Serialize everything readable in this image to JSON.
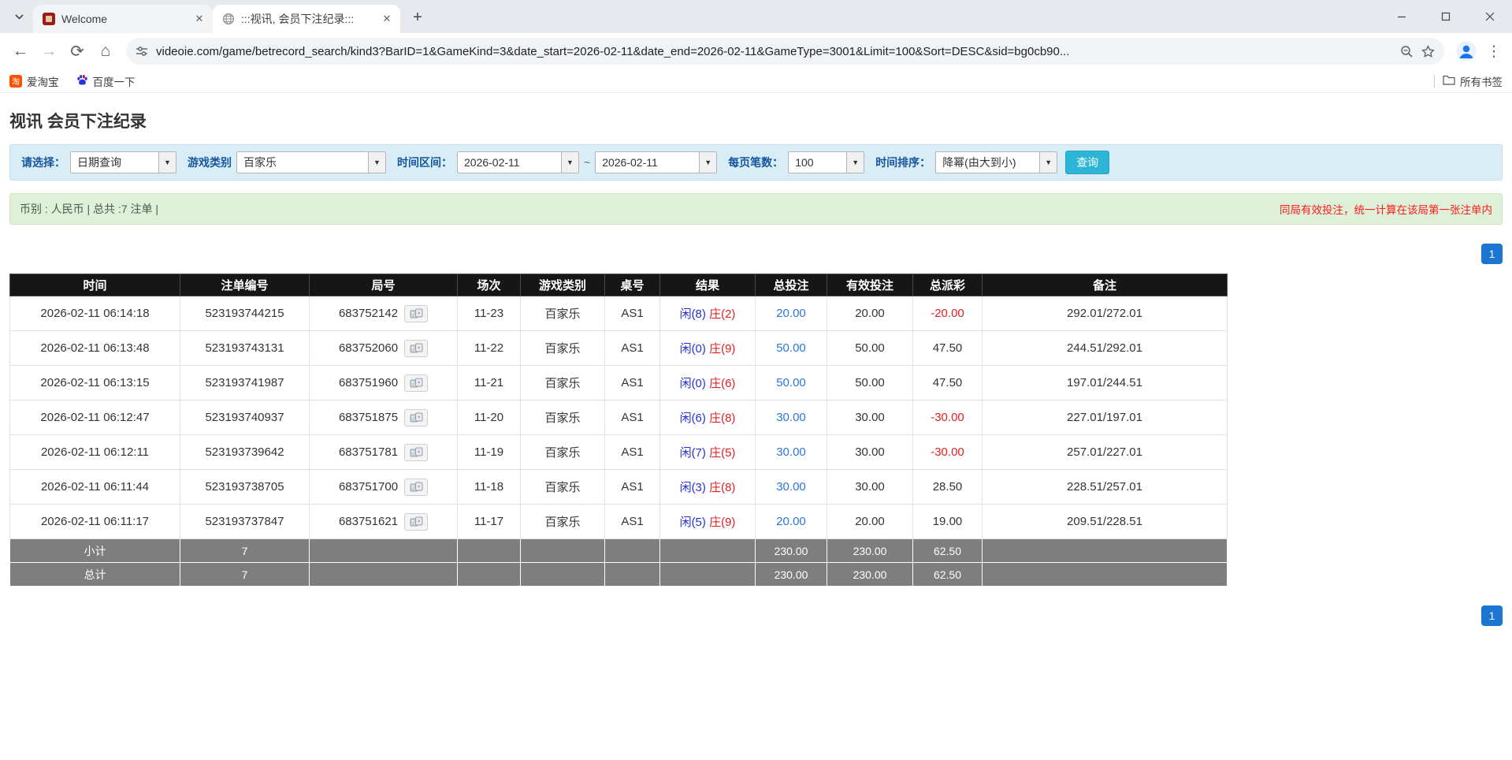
{
  "browser": {
    "tabs": [
      {
        "title": "Welcome"
      },
      {
        "title": ":::视讯, 会员下注纪录:::"
      }
    ],
    "url": "videoie.com/game/betrecord_search/kind3?BarID=1&GameKind=3&date_start=2026-02-11&date_end=2026-02-11&GameType=3001&Limit=100&Sort=DESC&sid=bg0cb90...",
    "bookmarks": [
      {
        "label": "爱淘宝"
      },
      {
        "label": "百度一下"
      }
    ],
    "all_bookmarks_label": "所有书签"
  },
  "page": {
    "title": "视讯 会员下注纪录",
    "filters": {
      "select_label": "请选择：",
      "select_value": "日期查询",
      "game_label": "游戏类别",
      "game_value": "百家乐",
      "range_label": "时间区间：",
      "date_start": "2026-02-11",
      "tilde": "~",
      "date_end": "2026-02-11",
      "per_page_label": "每页笔数：",
      "per_page_value": "100",
      "sort_label": "时间排序：",
      "sort_value": "降幂(由大到小)",
      "search_button": "查询"
    },
    "summary_left": "币别 : 人民币 | 总共 :7 注单 |",
    "summary_right": "同局有效投注，统一计算在该局第一张注单内",
    "pagination_page": "1"
  },
  "table": {
    "headers": [
      "时间",
      "注单编号",
      "局号",
      "场次",
      "游戏类别",
      "桌号",
      "结果",
      "总投注",
      "有效投注",
      "总派彩",
      "备注"
    ],
    "rows": [
      {
        "time": "2026-02-11 06:14:18",
        "bet_no": "523193744215",
        "round_no": "683752142",
        "session": "11-23",
        "game": "百家乐",
        "table_no": "AS1",
        "result_player": "闲(8)",
        "result_banker": "庄(2)",
        "total_bet": "20.00",
        "valid_bet": "20.00",
        "payout": "-20.00",
        "note": "292.01/272.01"
      },
      {
        "time": "2026-02-11 06:13:48",
        "bet_no": "523193743131",
        "round_no": "683752060",
        "session": "11-22",
        "game": "百家乐",
        "table_no": "AS1",
        "result_player": "闲(0)",
        "result_banker": "庄(9)",
        "total_bet": "50.00",
        "valid_bet": "50.00",
        "payout": "47.50",
        "note": "244.51/292.01"
      },
      {
        "time": "2026-02-11 06:13:15",
        "bet_no": "523193741987",
        "round_no": "683751960",
        "session": "11-21",
        "game": "百家乐",
        "table_no": "AS1",
        "result_player": "闲(0)",
        "result_banker": "庄(6)",
        "total_bet": "50.00",
        "valid_bet": "50.00",
        "payout": "47.50",
        "note": "197.01/244.51"
      },
      {
        "time": "2026-02-11 06:12:47",
        "bet_no": "523193740937",
        "round_no": "683751875",
        "session": "11-20",
        "game": "百家乐",
        "table_no": "AS1",
        "result_player": "闲(6)",
        "result_banker": "庄(8)",
        "total_bet": "30.00",
        "valid_bet": "30.00",
        "payout": "-30.00",
        "note": "227.01/197.01"
      },
      {
        "time": "2026-02-11 06:12:11",
        "bet_no": "523193739642",
        "round_no": "683751781",
        "session": "11-19",
        "game": "百家乐",
        "table_no": "AS1",
        "result_player": "闲(7)",
        "result_banker": "庄(5)",
        "total_bet": "30.00",
        "valid_bet": "30.00",
        "payout": "-30.00",
        "note": "257.01/227.01"
      },
      {
        "time": "2026-02-11 06:11:44",
        "bet_no": "523193738705",
        "round_no": "683751700",
        "session": "11-18",
        "game": "百家乐",
        "table_no": "AS1",
        "result_player": "闲(3)",
        "result_banker": "庄(8)",
        "total_bet": "30.00",
        "valid_bet": "30.00",
        "payout": "28.50",
        "note": "228.51/257.01"
      },
      {
        "time": "2026-02-11 06:11:17",
        "bet_no": "523193737847",
        "round_no": "683751621",
        "session": "11-17",
        "game": "百家乐",
        "table_no": "AS1",
        "result_player": "闲(5)",
        "result_banker": "庄(9)",
        "total_bet": "20.00",
        "valid_bet": "20.00",
        "payout": "19.00",
        "note": "209.51/228.51"
      }
    ],
    "subtotal": {
      "label": "小计",
      "count": "7",
      "total_bet": "230.00",
      "valid_bet": "230.00",
      "payout": "62.50"
    },
    "grand_total": {
      "label": "总计",
      "count": "7",
      "total_bet": "230.00",
      "valid_bet": "230.00",
      "payout": "62.50"
    }
  },
  "colors": {
    "filter_bar_bg": "#d9edf7",
    "summary_bar_bg": "#dff0d8",
    "search_button_bg": "#2cb5d6",
    "pagination_bg": "#1b75d1",
    "total_bet_blue": "#2b77d9",
    "player_blue": "#2530d2",
    "banker_red": "#e02020",
    "negative_red": "#e02020",
    "header_bg": "#161616",
    "sum_row_bg": "#7e7e7e"
  }
}
